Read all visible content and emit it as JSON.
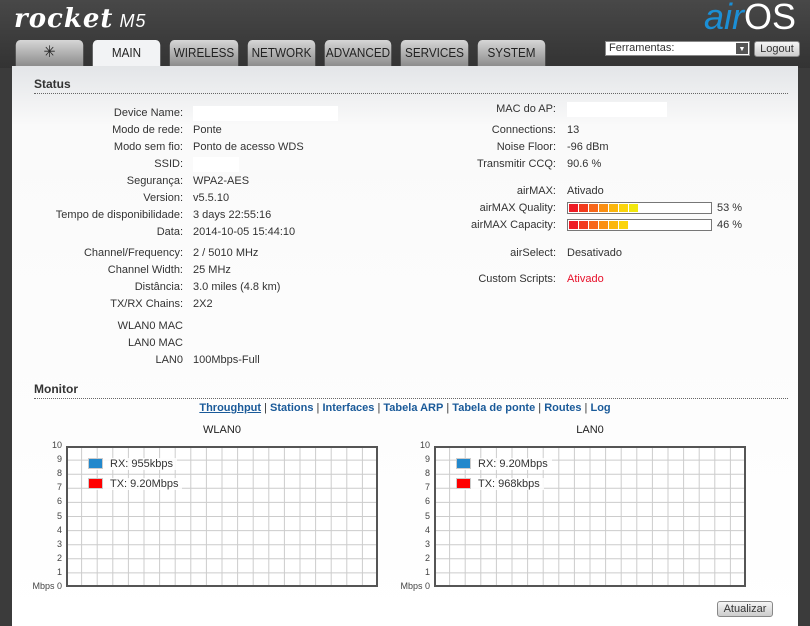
{
  "header": {
    "product": "rocket",
    "model": "M5",
    "brand_air": "air",
    "brand_os": "OS"
  },
  "tabs": [
    {
      "label": ""
    },
    {
      "label": "MAIN"
    },
    {
      "label": "WIRELESS"
    },
    {
      "label": "NETWORK"
    },
    {
      "label": "ADVANCED"
    },
    {
      "label": "SERVICES"
    },
    {
      "label": "SYSTEM"
    }
  ],
  "tools": {
    "selected": "Ferramentas:",
    "logout": "Logout"
  },
  "status": {
    "title": "Status",
    "left": [
      {
        "label": "Device Name:",
        "value": ""
      },
      {
        "label": "Modo de rede:",
        "value": "Ponte"
      },
      {
        "label": "Modo sem fio:",
        "value": "Ponto de acesso WDS"
      },
      {
        "label": "SSID:",
        "value": ""
      },
      {
        "label": "Segurança:",
        "value": "WPA2-AES"
      },
      {
        "label": "Version:",
        "value": "v5.5.10"
      },
      {
        "label": "Tempo de disponibilidade:",
        "value": "3 days 22:55:16"
      },
      {
        "label": "Data:",
        "value": "2014-10-05 15:44:10"
      },
      {
        "label": "Channel/Frequency:",
        "value": "2 / 5010 MHz"
      },
      {
        "label": "Channel Width:",
        "value": "25 MHz"
      },
      {
        "label": "Distância:",
        "value": "3.0 miles (4.8 km)"
      },
      {
        "label": "TX/RX Chains:",
        "value": "2X2"
      },
      {
        "label": "WLAN0 MAC",
        "value": ""
      },
      {
        "label": "LAN0 MAC",
        "value": ""
      },
      {
        "label": "LAN0",
        "value": "100Mbps-Full"
      }
    ],
    "right": [
      {
        "label": "MAC do AP:",
        "value": ""
      },
      {
        "label": "Connections:",
        "value": "13"
      },
      {
        "label": "Noise Floor:",
        "value": "-96 dBm"
      },
      {
        "label": "Transmitir CCQ:",
        "value": "90.6 %"
      },
      {
        "label": "airMAX:",
        "value": "Ativado"
      },
      {
        "label": "airMAX Quality:",
        "value": "53 %",
        "percent": 53
      },
      {
        "label": "airMAX Capacity:",
        "value": "46 %",
        "percent": 46
      },
      {
        "label": "airSelect:",
        "value": "Desativado"
      },
      {
        "label": "Custom Scripts:",
        "value": "Ativado",
        "color": "#e8102a"
      }
    ]
  },
  "monitor": {
    "title": "Monitor",
    "links": [
      "Throughput",
      "Stations",
      "Interfaces",
      "Tabela ARP",
      "Tabela de ponte",
      "Routes",
      "Log"
    ],
    "active": "Throughput",
    "refresh": "Atualizar"
  },
  "chart_data": [
    {
      "type": "line",
      "title": "WLAN0",
      "ylabel": "Mbps",
      "ylim": [
        0,
        10
      ],
      "yticks": [
        "0",
        "1",
        "2",
        "3",
        "4",
        "5",
        "6",
        "7",
        "8",
        "9",
        "10"
      ],
      "grid": true,
      "legend": "top-left",
      "series": [
        {
          "name": "RX: 955kbps",
          "color": "#2288cc",
          "values": []
        },
        {
          "name": "TX: 9.20Mbps",
          "color": "#ff0000",
          "values": []
        }
      ]
    },
    {
      "type": "line",
      "title": "LAN0",
      "ylabel": "Mbps",
      "ylim": [
        0,
        10
      ],
      "yticks": [
        "0",
        "1",
        "2",
        "3",
        "4",
        "5",
        "6",
        "7",
        "8",
        "9",
        "10"
      ],
      "grid": true,
      "legend": "top-left",
      "series": [
        {
          "name": "RX: 9.20Mbps",
          "color": "#2288cc",
          "values": []
        },
        {
          "name": "TX: 968kbps",
          "color": "#ff0000",
          "values": []
        }
      ]
    }
  ]
}
